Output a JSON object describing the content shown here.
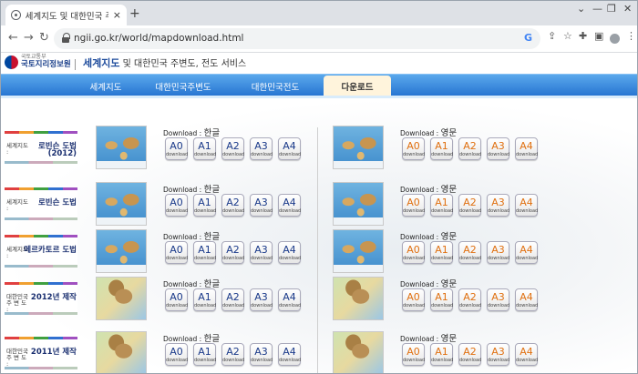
{
  "browser": {
    "tab_title": "세계지도 및 대한민국 주변도 서",
    "url": "ngii.go.kr/world/mapdownload.html"
  },
  "header": {
    "org_small": "국토교통부",
    "org_name": "국토지리정보원",
    "site_title_bold": "세계지도",
    "site_title_rest": "및 대한민국 주변도, 전도 서비스"
  },
  "gnb": [
    "세계지도",
    "대한민국주변도",
    "대한민국전도",
    "다운로드"
  ],
  "download_label": "Download",
  "lang": {
    "ko": "한글",
    "en": "영문"
  },
  "sizes": [
    "A0",
    "A1",
    "A2",
    "A3",
    "A4"
  ],
  "btn_sub": "download",
  "rows": [
    {
      "prefix": "세계지도 :",
      "name": "로빈슨 도법",
      "name2": "(2012)"
    },
    {
      "prefix": "세계지도 :",
      "name": "로빈슨 도법"
    },
    {
      "prefix": "세계지도 :",
      "name": "메르카토르 도법"
    },
    {
      "prefix": "대한민국 주 변 도 :",
      "name": "2012년 제작"
    },
    {
      "prefix": "대한민국 주 변 도 :",
      "name": "2011년 제작"
    }
  ]
}
